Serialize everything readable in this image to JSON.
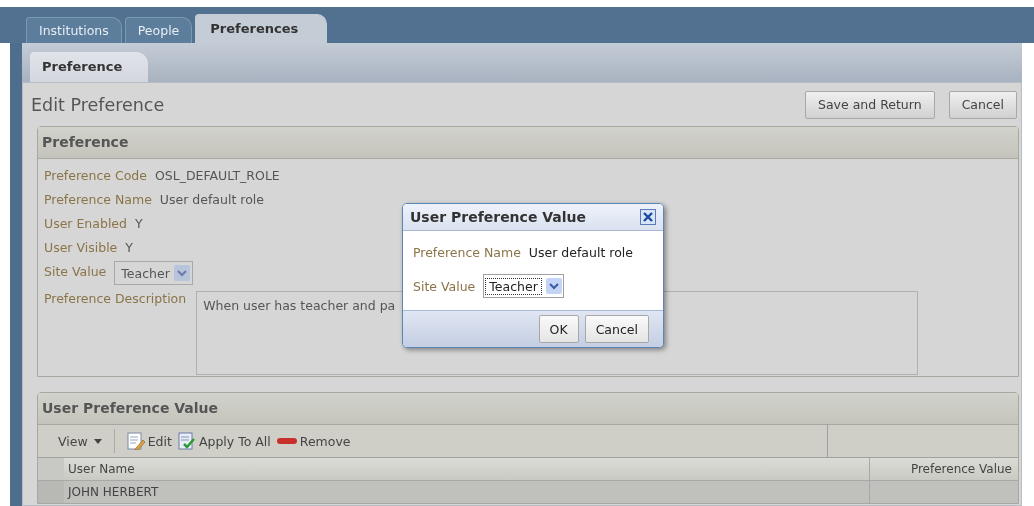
{
  "tabs": [
    {
      "label": "Institutions",
      "selected": false
    },
    {
      "label": "People",
      "selected": false
    },
    {
      "label": "Preferences",
      "selected": true
    }
  ],
  "subtabs": [
    {
      "label": "Preference",
      "selected": true
    }
  ],
  "page": {
    "title": "Edit Preference",
    "buttons": [
      "Save and Return",
      "Cancel"
    ]
  },
  "preference_section": {
    "title": "Preference",
    "fields": [
      {
        "label": "Preference Code",
        "value": "OSL_DEFAULT_ROLE"
      },
      {
        "label": "Preference Name",
        "value": "User default role"
      },
      {
        "label": "User Enabled",
        "value": "Y"
      },
      {
        "label": "User Visible",
        "value": "Y"
      }
    ],
    "site_value": {
      "label": "Site Value",
      "value": "Teacher"
    },
    "description": {
      "label": "Preference Description",
      "value": "When user has teacher and pa"
    }
  },
  "dialog": {
    "title": "User Preference Value",
    "fields": [
      {
        "label": "Preference Name",
        "value": "User default role"
      }
    ],
    "site_value": {
      "label": "Site Value",
      "value": "Teacher"
    },
    "buttons": [
      "OK",
      "Cancel"
    ]
  },
  "user_value_section": {
    "title": "User Preference Value",
    "toolbar": [
      {
        "kind": "menu",
        "label": "View"
      },
      {
        "kind": "edit",
        "label": "Edit"
      },
      {
        "kind": "apply",
        "label": "Apply To All"
      },
      {
        "kind": "remove",
        "label": "Remove"
      }
    ],
    "columns": [
      "User Name",
      "Preference Value"
    ],
    "rows": [
      {
        "cells": [
          "JOHN HERBERT",
          ""
        ]
      }
    ]
  }
}
